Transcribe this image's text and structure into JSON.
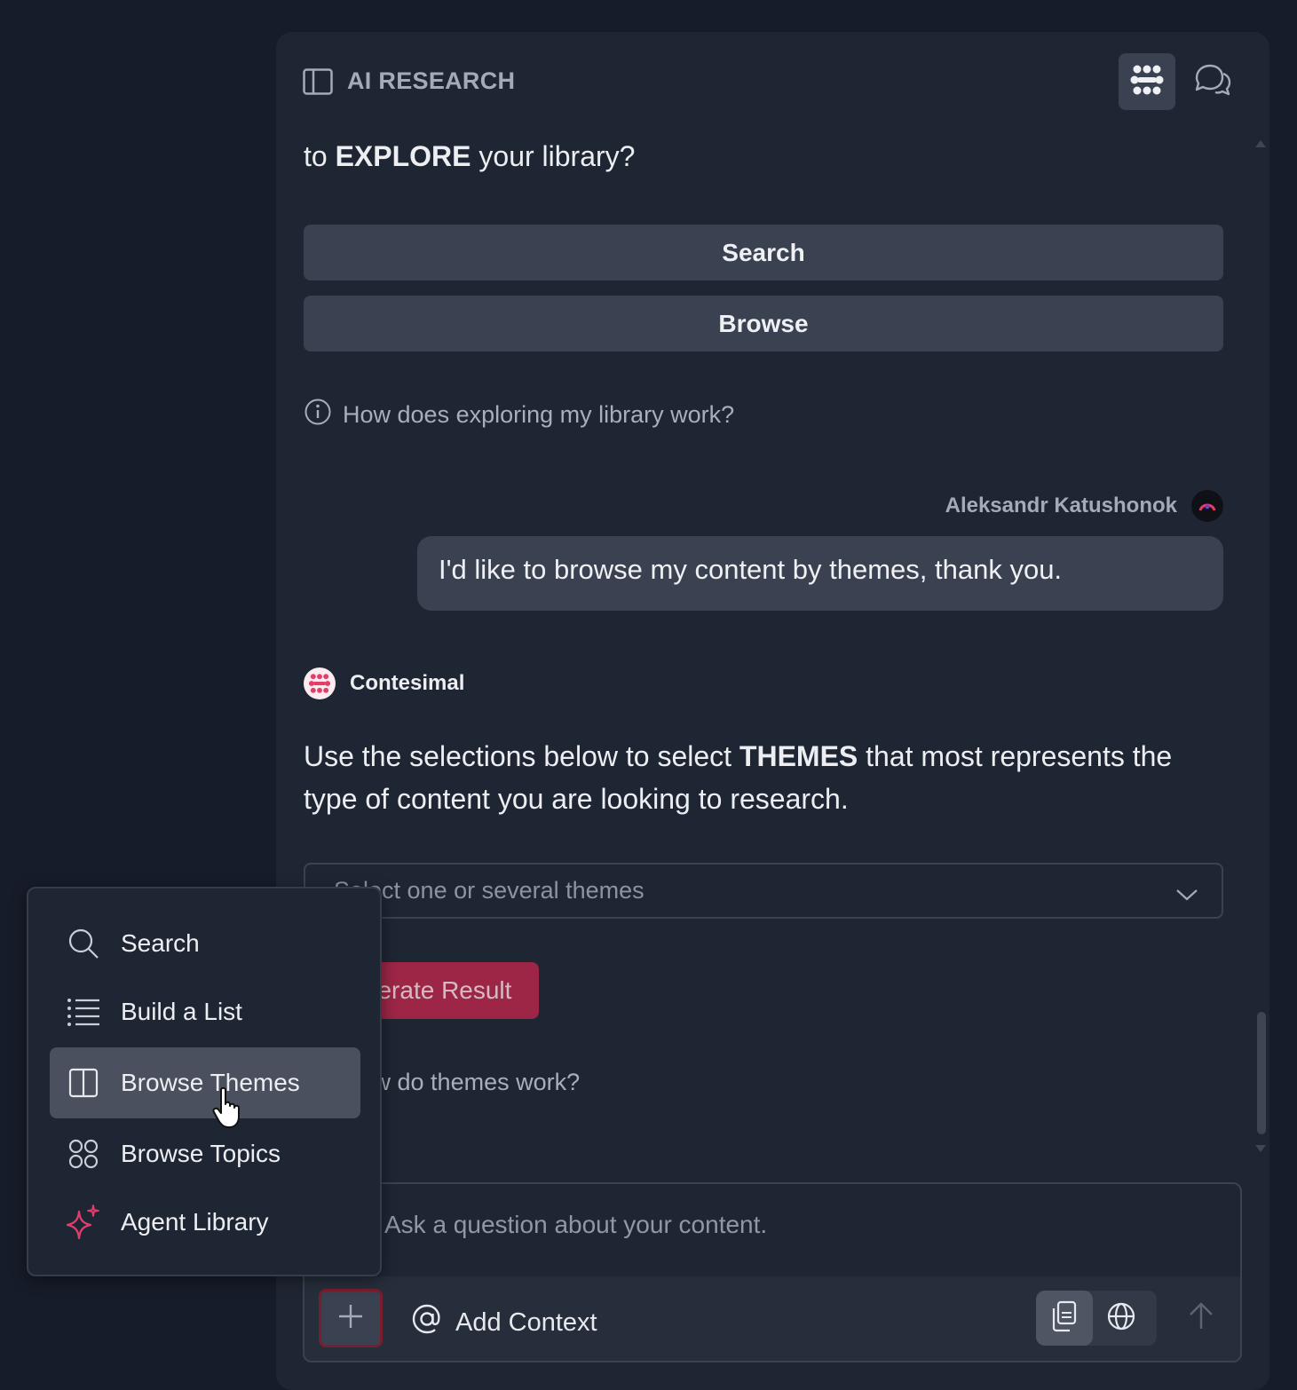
{
  "header": {
    "title": "AI RESEARCH",
    "icons": [
      "sidebar-toggle-icon",
      "knowledge-graph-icon",
      "chat-bubbles-icon"
    ]
  },
  "conversation": {
    "intro_prefix": "to ",
    "intro_bold": "EXPLORE",
    "intro_suffix": " your library?",
    "buttons": {
      "search": "Search",
      "browse": "Browse"
    },
    "explore_help": "How does exploring my library work?",
    "user": {
      "name": "Aleksandr Katushonok",
      "message": "I'd like to browse my content by themes, thank you."
    },
    "bot": {
      "name": "Contesimal",
      "text_prefix": "Use the selections below to select ",
      "text_bold": "THEMES",
      "text_suffix": " that most represents the type of content you are looking to research.",
      "select_placeholder": "Select one or several themes",
      "generate_label": "Generate Result",
      "themes_help": "How do themes work?"
    }
  },
  "composer": {
    "placeholder": "Ask a question about your content.",
    "add_context": "Add Context"
  },
  "menu": {
    "items": [
      {
        "label": "Search",
        "icon": "search-icon"
      },
      {
        "label": "Build a List",
        "icon": "list-icon"
      },
      {
        "label": "Browse Themes",
        "icon": "columns-icon",
        "selected": true
      },
      {
        "label": "Browse Topics",
        "icon": "grid-circles-icon"
      },
      {
        "label": "Agent Library",
        "icon": "sparkles-icon"
      }
    ]
  },
  "colors": {
    "background": "#161c29",
    "panel": "#1f2633",
    "button": "#3a4150",
    "accent": "#b3264a",
    "muted_text": "#a4abb8"
  }
}
